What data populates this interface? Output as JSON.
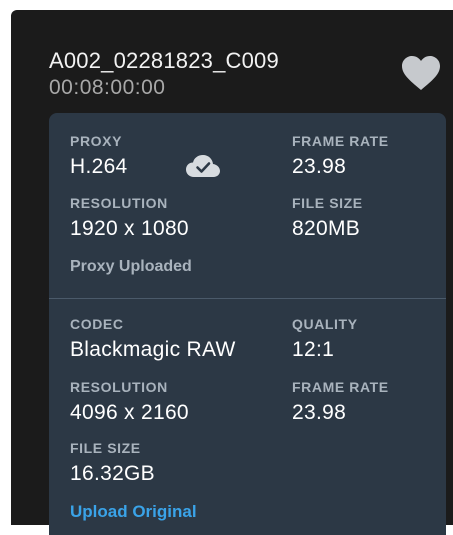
{
  "clip": {
    "name": "A002_02281823_C009",
    "timecode": "00:08:00:00"
  },
  "proxy": {
    "proxy_label": "PROXY",
    "proxy_value": "H.264",
    "cloud_icon": "cloud-check-icon",
    "frame_rate_label": "FRAME RATE",
    "frame_rate_value": "23.98",
    "resolution_label": "RESOLUTION",
    "resolution_value": "1920 x 1080",
    "file_size_label": "FILE SIZE",
    "file_size_value": "820MB",
    "status": "Proxy Uploaded"
  },
  "original": {
    "codec_label": "CODEC",
    "codec_value": "Blackmagic RAW",
    "quality_label": "QUALITY",
    "quality_value": "12:1",
    "resolution_label": "RESOLUTION",
    "resolution_value": "4096 x 2160",
    "frame_rate_label": "FRAME RATE",
    "frame_rate_value": "23.98",
    "file_size_label": "FILE SIZE",
    "file_size_value": "16.32GB",
    "upload_link": "Upload Original"
  },
  "colors": {
    "panel_bg": "#1b1b1b",
    "card_bg": "#2c3845",
    "label": "#a9b3bd",
    "link": "#3aa3e8"
  }
}
